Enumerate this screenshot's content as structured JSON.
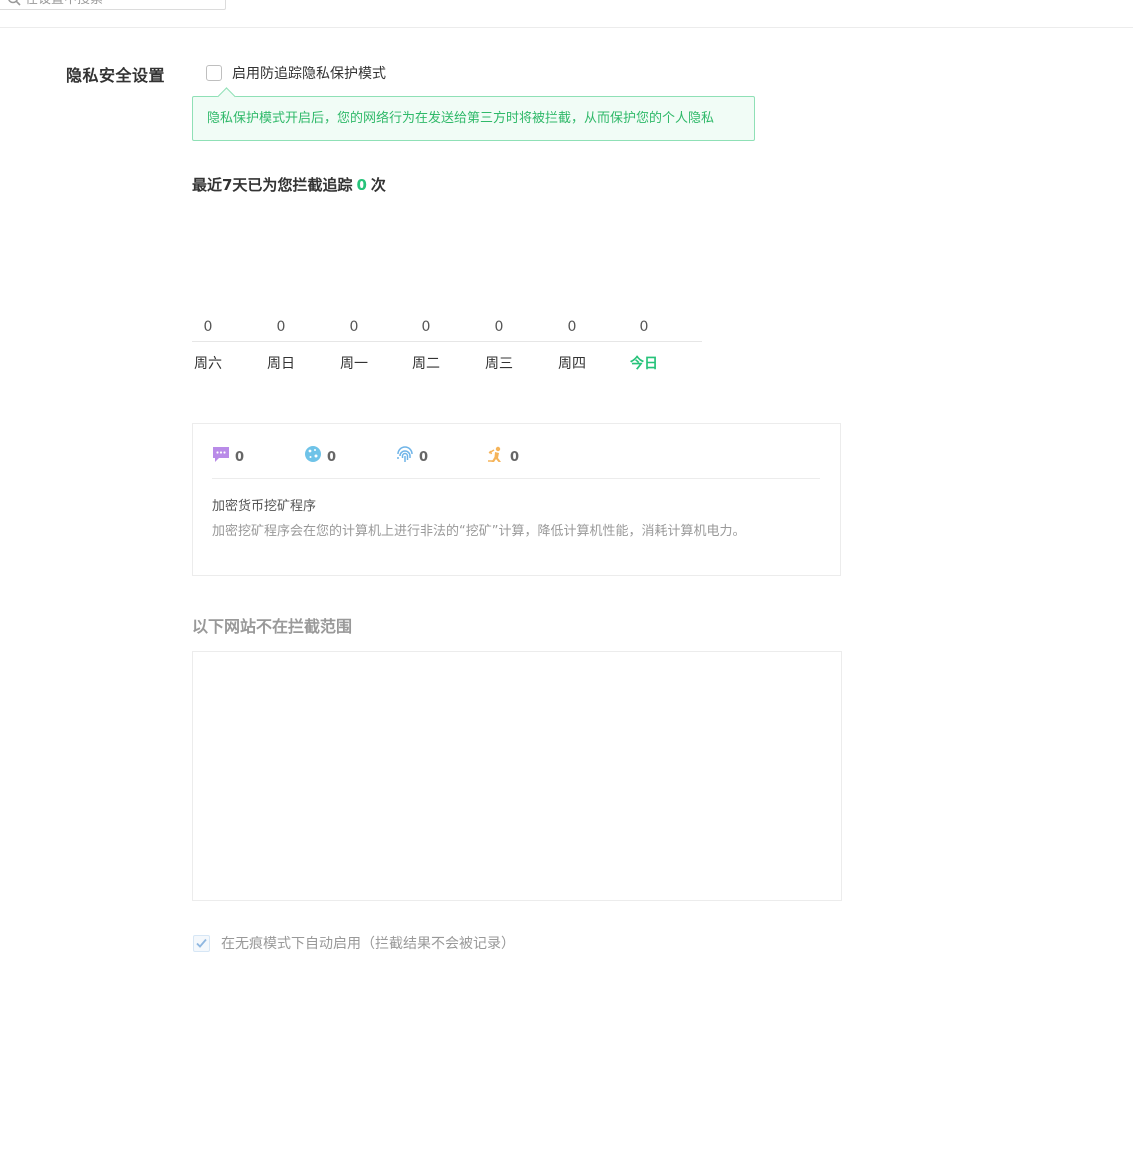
{
  "search": {
    "placeholder": "在设置中搜索"
  },
  "privacy": {
    "section_label": "隐私安全设置",
    "enable_label": "启用防追踪隐私保护模式",
    "enabled": false,
    "tip": "隐私保护模式开启后，您的网络行为在发送给第三方时将被拦截，从而保护您的个人隐私"
  },
  "stats": {
    "title_prefix": "最近7天已为您拦截追踪",
    "count": "0",
    "title_suffix": "次",
    "days": [
      {
        "label": "周六",
        "value": "0",
        "today": false
      },
      {
        "label": "周日",
        "value": "0",
        "today": false
      },
      {
        "label": "周一",
        "value": "0",
        "today": false
      },
      {
        "label": "周二",
        "value": "0",
        "today": false
      },
      {
        "label": "周三",
        "value": "0",
        "today": false
      },
      {
        "label": "周四",
        "value": "0",
        "today": false
      },
      {
        "label": "今日",
        "value": "0",
        "today": true
      }
    ]
  },
  "categories": {
    "items": [
      {
        "icon": "chat-bubble-icon",
        "count": "0",
        "color": "#b98be8"
      },
      {
        "icon": "cookie-icon",
        "count": "0",
        "color": "#6fc3e8"
      },
      {
        "icon": "fingerprint-icon",
        "count": "0",
        "color": "#6fb4e8"
      },
      {
        "icon": "miner-icon",
        "count": "0",
        "color": "#f5b45a"
      }
    ],
    "selected_title": "加密货币挖矿程序",
    "selected_desc": "加密挖矿程序会在您的计算机上进行非法的“挖矿”计算，降低计算机性能，消耗计算机电力。"
  },
  "exclusions": {
    "title": "以下网站不在拦截范围",
    "sites": []
  },
  "incognito": {
    "label": "在无痕模式下自动启用（拦截结果不会被记录）",
    "checked": true
  },
  "colors": {
    "accent": "#27c37a",
    "tip_border": "#8fe0b6",
    "tip_bg": "#f1fcf6"
  }
}
